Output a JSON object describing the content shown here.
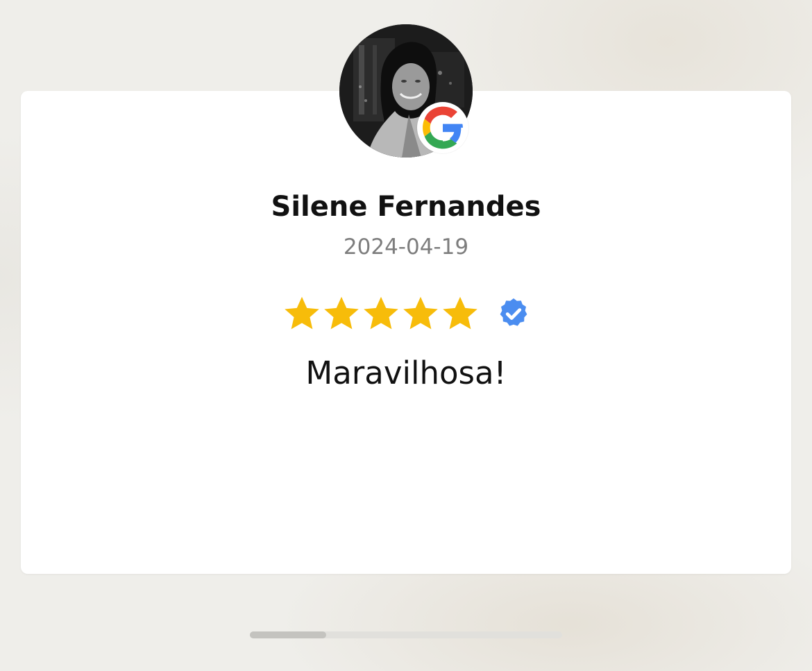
{
  "review": {
    "reviewer_name": "Silene Fernandes",
    "date": "2024-04-19",
    "rating": 5,
    "rating_max": 5,
    "text": "Maravilhosa!",
    "source_icon": "google-icon",
    "verified_icon": "verified-check-icon"
  },
  "carousel": {
    "progress_fraction": 0.245
  },
  "colors": {
    "star": "#f7bc0a",
    "verified": "#4b8df0",
    "google_blue": "#4285f4",
    "google_red": "#ea4335",
    "google_yellow": "#fbbc05",
    "google_green": "#34a853"
  }
}
